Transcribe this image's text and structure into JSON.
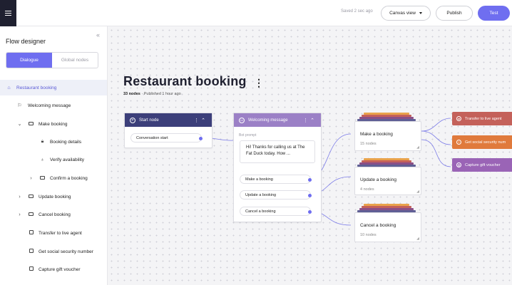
{
  "topbar": {
    "saved_text": "Saved 2 sec ago",
    "canvas_view_label": "Canvas view",
    "publish_label": "Publish",
    "test_label": "Test"
  },
  "sidebar": {
    "title": "Flow designer",
    "tabs": [
      "Dialogue",
      "Global nodes"
    ],
    "items": [
      {
        "label": "Restaurant booking",
        "icon": "home-icon"
      },
      {
        "label": "Welcoming message",
        "icon": "flag-icon"
      },
      {
        "label": "Make booking",
        "icon": "folder-icon"
      },
      {
        "label": "Booking details",
        "icon": "lock-icon"
      },
      {
        "label": "Verify availability",
        "icon": "lightbulb-icon"
      },
      {
        "label": "Confirm a booking",
        "icon": "folder-icon"
      },
      {
        "label": "Update booking",
        "icon": "folder-icon"
      },
      {
        "label": "Cancel booking",
        "icon": "folder-icon"
      },
      {
        "label": "Transfer to live agent",
        "icon": "node-icon"
      },
      {
        "label": "Get social security number",
        "icon": "node-icon"
      },
      {
        "label": "Capture gift voucher",
        "icon": "node-icon"
      }
    ]
  },
  "canvas": {
    "title": "Restaurant booking",
    "node_count": "33 nodes",
    "published": " · Published 1 hour ago",
    "start_node": {
      "title": "Start node",
      "trigger": "Conversation start"
    },
    "welcome_node": {
      "title": "Welcoming message",
      "prompt_label": "Bot prompt",
      "prompt_text": "Hi! Thanks for calling us at The Fat Duck today. How ...",
      "options": [
        "Make a booking",
        "Update a booking",
        "Cancel a booking"
      ]
    },
    "flows": [
      {
        "title": "Make a booking",
        "nodes": "15 nodes"
      },
      {
        "title": "Update a booking",
        "nodes": "4 nodes"
      },
      {
        "title": "Cancel a booking",
        "nodes": "10 nodes"
      }
    ],
    "agents": [
      {
        "label": "Transfer to live agent",
        "color": "#c4615a"
      },
      {
        "label": "Get social security num",
        "color": "#e07a3c"
      },
      {
        "label": "Capture gift voucher",
        "color": "#9a64b6"
      }
    ]
  },
  "colors": {
    "accent": "#6f6ef0",
    "start_node": "#3c3f7a",
    "welcome_node": "#9b80c6",
    "stack": [
      "#e9a24b",
      "#c4615a",
      "#8a4f86",
      "#5f5f95"
    ]
  }
}
